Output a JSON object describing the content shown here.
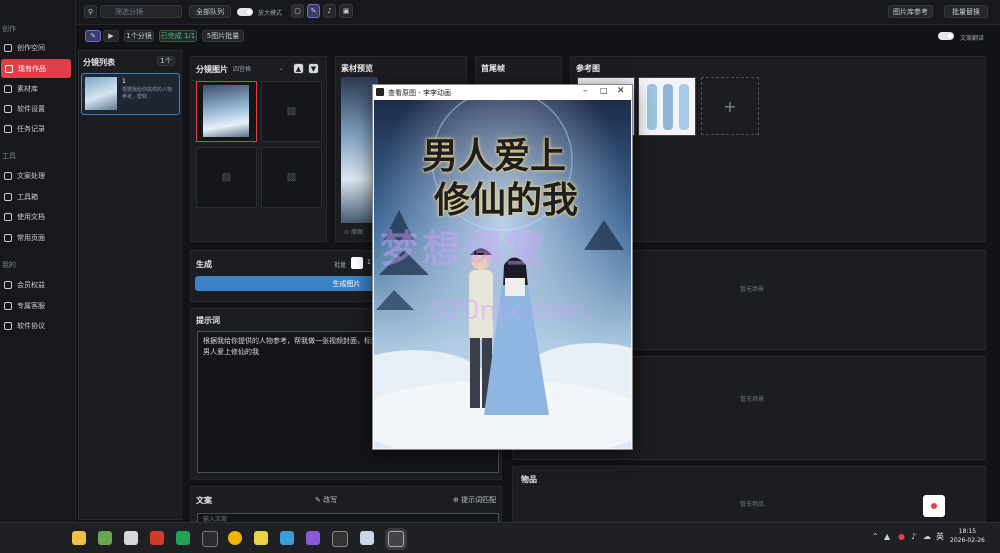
{
  "sidebar": {
    "section1": "创作",
    "items1": [
      "创作空间",
      "现有作品",
      "素材库",
      "软件设置",
      "任务记录"
    ],
    "section2": "工具",
    "items2": [
      "文案处理",
      "工具箱",
      "使用文档",
      "常用页面"
    ],
    "section3": "我的",
    "items3": [
      "会员权益",
      "专属客服",
      "软件协议"
    ]
  },
  "topbar": {
    "search_placeholder": "筛选分镜",
    "queue_button": "全部队列",
    "zoom_label": "放大模式",
    "ref_button": "图片库参考",
    "batch_button": "批量替换"
  },
  "subbar": {
    "count_badge": "1个分镜",
    "done_badge": "已完成 1/1",
    "image_batch": "5图片批量",
    "translate_label": "文案翻译"
  },
  "storyboard": {
    "title": "分镜列表",
    "count": "1个",
    "item_index": "1",
    "item_text": "根据我给你提供的人物参考，帮我..."
  },
  "shot_images": {
    "title": "分镜图片",
    "select": "四宫格"
  },
  "material_preview": {
    "title": "素材预览",
    "caption": "原图"
  },
  "first_frame": {
    "title": "首尾帧"
  },
  "reference": {
    "title": "参考图"
  },
  "generate": {
    "title": "生成",
    "qty_label": "批量",
    "qty_value": "1",
    "button": "生成图片"
  },
  "prompt": {
    "title": "提示词",
    "text": "根据我给你提供的人物参考，帮我做一张视频封面，标题：修仙的我，不能挡住人，名字是：男人爱上修仙的我"
  },
  "script": {
    "title": "文案",
    "rewrite": "改写",
    "match": "提示词匹配",
    "placeholder": "输入文案"
  },
  "right_slots": {
    "empty1": "暂无场景",
    "empty2": "暂无场景",
    "prop_title": "物品",
    "empty3": "暂无物品"
  },
  "viewer": {
    "title": "查看原图 - 李李动画",
    "poster_title_line1": "男人爱上",
    "poster_title_line2": "修仙的我",
    "watermark": "梦想课堂",
    "watermark_url": "520ntx.com"
  },
  "taskbar": {
    "time": "18:15",
    "date": "2026-02-26",
    "ime": "英"
  },
  "colors": {
    "accent": "#e0404a",
    "blue": "#3b82c4",
    "bg": "#121317"
  }
}
